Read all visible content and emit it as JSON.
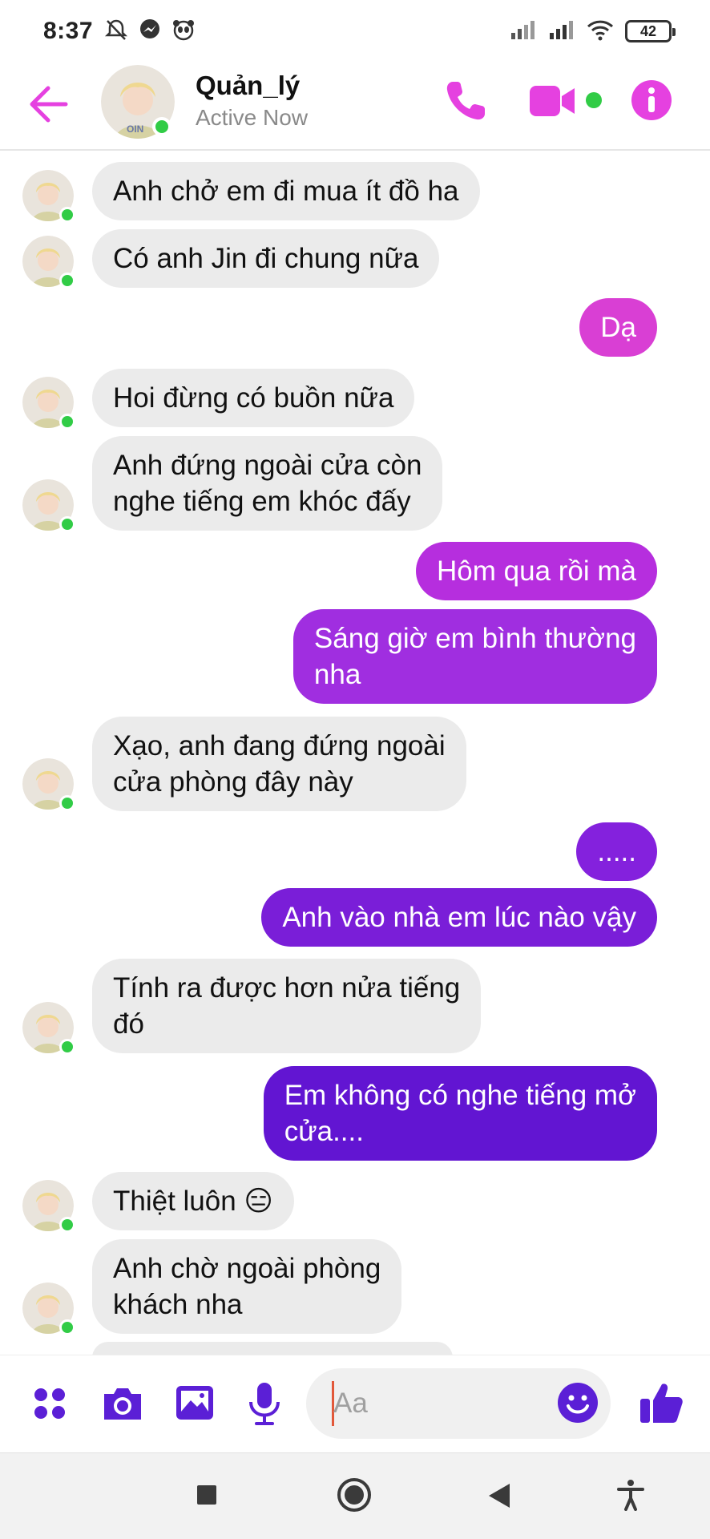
{
  "status_bar": {
    "time": "8:37",
    "battery": "42"
  },
  "header": {
    "contact_name": "Quản_lý",
    "contact_status": "Active Now"
  },
  "colors": {
    "accent": "#e541e0",
    "online": "#31cc46",
    "incoming_bubble": "#ebebeb"
  },
  "messages": [
    {
      "dir": "in",
      "text": "Anh chở em đi mua ít đồ ha"
    },
    {
      "dir": "in",
      "text": "Có anh Jin đi chung nữa"
    },
    {
      "dir": "out",
      "text": "Dạ"
    },
    {
      "dir": "in",
      "text": "Hoi đừng có buồn nữa"
    },
    {
      "dir": "in",
      "text": "Anh đứng ngoài cửa còn\nnghe tiếng em khóc đấy"
    },
    {
      "dir": "out",
      "text": "Hôm qua rồi mà"
    },
    {
      "dir": "out",
      "text": "Sáng giờ em bình thường\nnha"
    },
    {
      "dir": "in",
      "text": "Xạo, anh đang đứng ngoài\ncửa phòng đây này"
    },
    {
      "dir": "out",
      "text": "....."
    },
    {
      "dir": "out",
      "text": "Anh vào nhà em lúc nào vậy"
    },
    {
      "dir": "in",
      "text": "Tính ra được hơn nửa tiếng\nđó"
    },
    {
      "dir": "out",
      "text": "Em không có nghe tiếng mở\ncửa...."
    },
    {
      "dir": "in",
      "text": "Thiệt luôn 😑"
    },
    {
      "dir": "in",
      "text": "Anh chờ ngoài phòng\nkhách nha"
    }
  ],
  "composer": {
    "placeholder": "Aa"
  }
}
